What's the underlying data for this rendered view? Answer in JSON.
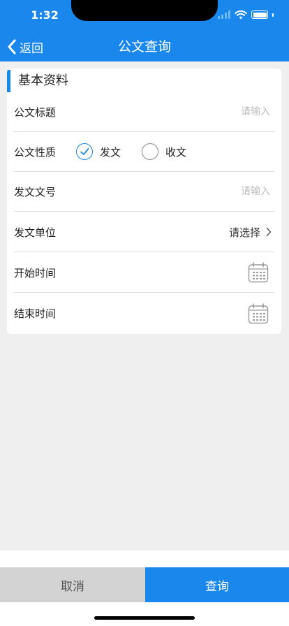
{
  "status_bar": {
    "time": "1:32"
  },
  "nav": {
    "back_label": "返回",
    "title": "公文查询"
  },
  "section": {
    "title": "基本资料"
  },
  "form": {
    "title_field": {
      "label": "公文标题",
      "placeholder": "请输入",
      "value": ""
    },
    "nature": {
      "label": "公文性质",
      "options": [
        {
          "label": "发文",
          "checked": true
        },
        {
          "label": "收文",
          "checked": false
        }
      ]
    },
    "doc_number": {
      "label": "发文文号",
      "placeholder": "请输入",
      "value": ""
    },
    "issuer": {
      "label": "发文单位",
      "value": "请选择"
    },
    "start_time": {
      "label": "开始时间"
    },
    "end_time": {
      "label": "结束时间"
    }
  },
  "footer": {
    "cancel_label": "取消",
    "query_label": "查询"
  },
  "colors": {
    "primary": "#1a87ec",
    "background": "#efefef",
    "cancel_bg": "#d3d3d3"
  },
  "icons": {
    "back": "chevron-left-icon",
    "wifi": "wifi-icon",
    "battery": "battery-icon",
    "check": "check-icon",
    "chevron": "chevron-right-icon",
    "calendar": "calendar-icon"
  }
}
